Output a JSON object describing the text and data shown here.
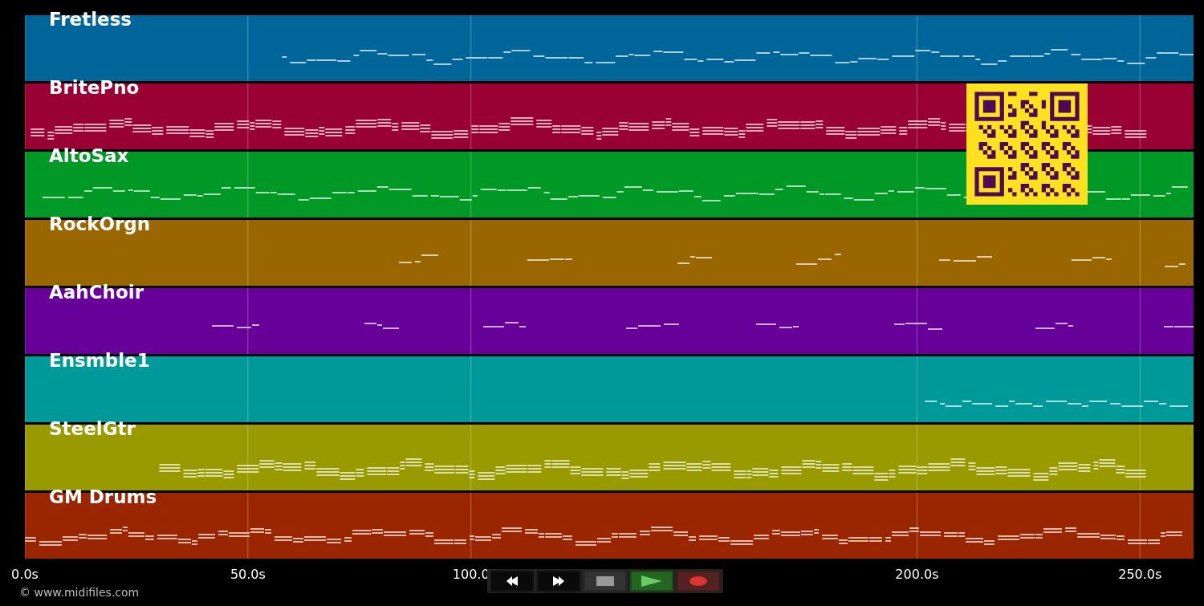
{
  "tracks": [
    {
      "name": "Fretless",
      "color": "#006699"
    },
    {
      "name": "BritePno",
      "color": "#990033"
    },
    {
      "name": "AltoSax",
      "color": "#009926"
    },
    {
      "name": "RockOrgn",
      "color": "#996600"
    },
    {
      "name": "AahChoir",
      "color": "#660099"
    },
    {
      "name": "Ensmble1",
      "color": "#009999"
    },
    {
      "name": "SteelGtr",
      "color": "#999900"
    },
    {
      "name": "GM Drums",
      "color": "#992600"
    }
  ],
  "axis": {
    "ticks": [
      "0.0s",
      "50.0s",
      "100.0",
      "200.0s",
      "250.0s"
    ]
  },
  "copyright": "© www.midifiles.com",
  "transport": [
    {
      "kind": "rewind"
    },
    {
      "kind": "forward"
    },
    {
      "kind": "stop"
    },
    {
      "kind": "play"
    },
    {
      "kind": "record"
    }
  ]
}
